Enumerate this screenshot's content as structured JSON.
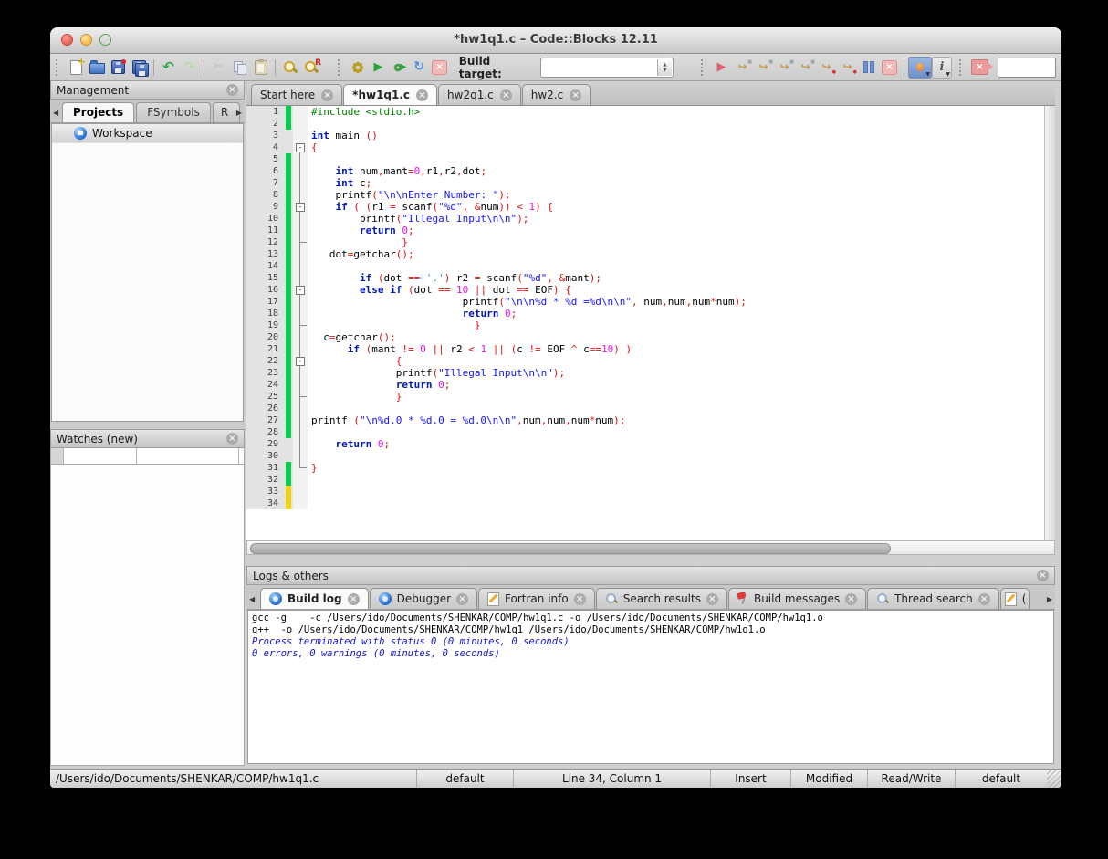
{
  "window": {
    "title": "*hw1q1.c – Code::Blocks 12.11"
  },
  "toolbar": {
    "build_target_label": "Build target:",
    "build_target_value": "",
    "search_value": ""
  },
  "icons": {
    "undo": "↶",
    "redo": "↷",
    "cut": "✂",
    "run": "▶",
    "rebuild": "↻",
    "debug_continue": "▶",
    "step": "↪",
    "close": "×",
    "fold_collapse": "-",
    "scroll_left": "◀",
    "scroll_right": "▶",
    "stepper_up": "▲",
    "stepper_down": "▼",
    "abort_x": "×",
    "info": "i",
    "shape_icons": "new-file:page-plus, open-file:folder, save:floppy, save-all:floppies, copy:pages, paste:clipboard, find:magnifier, replace:magnifier-R, build:gear, build-and-run:gear-play, pause:bars, debugging-windows:bug, incremental-search:pink-arrow-x, workspace:blue-sphere, build-log:blue-gear, fortran:pencil, search:magnifier, build-messages:red-flag"
  },
  "colors": {
    "change_bar_saved": "#00d24b",
    "change_bar_unsaved": "#f2d40e",
    "preprocessor": "#008000",
    "keyword": "#0018b4",
    "string": "#1414ff",
    "character": "#2e9bd6",
    "number": "#e813e8",
    "operator": "#e01010"
  },
  "sidebar": {
    "management": {
      "title": "Management",
      "tabs": [
        {
          "label": "Projects",
          "active": true,
          "partial": false
        },
        {
          "label": "FSymbols",
          "active": false,
          "partial": false
        },
        {
          "label": "R",
          "active": false,
          "partial": true
        }
      ],
      "workspace_label": "Workspace"
    },
    "watches": {
      "title": "Watches (new)"
    }
  },
  "editor": {
    "tabs": [
      {
        "label": "Start here",
        "active": false
      },
      {
        "label": "*hw1q1.c",
        "active": true
      },
      {
        "label": "hw2q1.c",
        "active": false
      },
      {
        "label": "hw2.c",
        "active": false
      }
    ],
    "lines": [
      {
        "n": 1,
        "bar": "g",
        "fold": "",
        "segs": [
          [
            "#include <stdio.h>",
            "pre"
          ]
        ]
      },
      {
        "n": 2,
        "bar": "g",
        "fold": "",
        "segs": []
      },
      {
        "n": 3,
        "bar": "",
        "fold": "",
        "segs": [
          [
            "int",
            "kw"
          ],
          [
            " main ",
            "pl"
          ],
          [
            "()",
            "op"
          ]
        ]
      },
      {
        "n": 4,
        "bar": "",
        "fold": "boxfirst",
        "segs": [
          [
            "{",
            "op"
          ]
        ]
      },
      {
        "n": 5,
        "bar": "g",
        "fold": "line",
        "segs": []
      },
      {
        "n": 6,
        "bar": "g",
        "fold": "line",
        "segs": [
          [
            "    ",
            "pl"
          ],
          [
            "int",
            "kw"
          ],
          [
            " num",
            "pl"
          ],
          [
            ",",
            "op"
          ],
          [
            "mant",
            "pl"
          ],
          [
            "=",
            "op"
          ],
          [
            "0",
            "num"
          ],
          [
            ",",
            "op"
          ],
          [
            "r1",
            "pl"
          ],
          [
            ",",
            "op"
          ],
          [
            "r2",
            "pl"
          ],
          [
            ",",
            "op"
          ],
          [
            "dot",
            "pl"
          ],
          [
            ";",
            "op"
          ]
        ]
      },
      {
        "n": 7,
        "bar": "g",
        "fold": "line",
        "segs": [
          [
            "    ",
            "pl"
          ],
          [
            "int",
            "kw"
          ],
          [
            " c",
            "pl"
          ],
          [
            ";",
            "op"
          ]
        ]
      },
      {
        "n": 8,
        "bar": "g",
        "fold": "line",
        "segs": [
          [
            "    printf",
            "pl"
          ],
          [
            "(",
            "op"
          ],
          [
            "\"\\n\\nEnter Number: \"",
            "str"
          ],
          [
            ");",
            "op"
          ]
        ]
      },
      {
        "n": 9,
        "bar": "g",
        "fold": "box",
        "segs": [
          [
            "    ",
            "pl"
          ],
          [
            "if",
            "kw"
          ],
          [
            " ",
            "pl"
          ],
          [
            "( (",
            "op"
          ],
          [
            "r1 ",
            "pl"
          ],
          [
            "=",
            "op"
          ],
          [
            " scanf",
            "pl"
          ],
          [
            "(",
            "op"
          ],
          [
            "\"%d\"",
            "str"
          ],
          [
            ",",
            "op"
          ],
          [
            " ",
            "pl"
          ],
          [
            "&",
            "op"
          ],
          [
            "num",
            "pl"
          ],
          [
            "))",
            "op"
          ],
          [
            " ",
            "pl"
          ],
          [
            "<",
            "op"
          ],
          [
            " ",
            "pl"
          ],
          [
            "1",
            "num"
          ],
          [
            ")",
            "op"
          ],
          [
            " ",
            "pl"
          ],
          [
            "{",
            "op"
          ]
        ]
      },
      {
        "n": 10,
        "bar": "g",
        "fold": "line",
        "segs": [
          [
            "        printf",
            "pl"
          ],
          [
            "(",
            "op"
          ],
          [
            "\"Illegal Input\\n\\n\"",
            "str"
          ],
          [
            ");",
            "op"
          ]
        ]
      },
      {
        "n": 11,
        "bar": "g",
        "fold": "line",
        "segs": [
          [
            "        ",
            "pl"
          ],
          [
            "return",
            "kw"
          ],
          [
            " ",
            "pl"
          ],
          [
            "0",
            "num"
          ],
          [
            ";",
            "op"
          ]
        ]
      },
      {
        "n": 12,
        "bar": "g",
        "fold": "tick",
        "segs": [
          [
            "               ",
            "pl"
          ],
          [
            "}",
            "op"
          ]
        ]
      },
      {
        "n": 13,
        "bar": "g",
        "fold": "line",
        "segs": [
          [
            "   dot",
            "pl"
          ],
          [
            "=",
            "op"
          ],
          [
            "getchar",
            "pl"
          ],
          [
            "();",
            "op"
          ]
        ]
      },
      {
        "n": 14,
        "bar": "g",
        "fold": "line",
        "segs": []
      },
      {
        "n": 15,
        "bar": "g",
        "fold": "line",
        "segs": [
          [
            "        ",
            "pl"
          ],
          [
            "if",
            "kw"
          ],
          [
            " ",
            "pl"
          ],
          [
            "(",
            "op"
          ],
          [
            "dot ",
            "pl"
          ],
          [
            "==",
            "op"
          ],
          [
            " ",
            "pl"
          ],
          [
            "'.'",
            "chr"
          ],
          [
            ")",
            "op"
          ],
          [
            " r2 ",
            "pl"
          ],
          [
            "=",
            "op"
          ],
          [
            " scanf",
            "pl"
          ],
          [
            "(",
            "op"
          ],
          [
            "\"%d\"",
            "str"
          ],
          [
            ",",
            "op"
          ],
          [
            " ",
            "pl"
          ],
          [
            "&",
            "op"
          ],
          [
            "mant",
            "pl"
          ],
          [
            ");",
            "op"
          ]
        ]
      },
      {
        "n": 16,
        "bar": "g",
        "fold": "box",
        "segs": [
          [
            "        ",
            "pl"
          ],
          [
            "else",
            "kw"
          ],
          [
            " ",
            "pl"
          ],
          [
            "if",
            "kw"
          ],
          [
            " ",
            "pl"
          ],
          [
            "(",
            "op"
          ],
          [
            "dot ",
            "pl"
          ],
          [
            "==",
            "op"
          ],
          [
            " ",
            "pl"
          ],
          [
            "10",
            "num"
          ],
          [
            " ",
            "pl"
          ],
          [
            "||",
            "op"
          ],
          [
            " dot ",
            "pl"
          ],
          [
            "==",
            "op"
          ],
          [
            " EOF",
            "pl"
          ],
          [
            ")",
            "op"
          ],
          [
            " ",
            "pl"
          ],
          [
            "{",
            "op"
          ]
        ]
      },
      {
        "n": 17,
        "bar": "g",
        "fold": "line",
        "segs": [
          [
            "                         printf",
            "pl"
          ],
          [
            "(",
            "op"
          ],
          [
            "\"\\n\\n%d * %d =%d\\n\\n\"",
            "str"
          ],
          [
            ",",
            "op"
          ],
          [
            " num",
            "pl"
          ],
          [
            ",",
            "op"
          ],
          [
            "num",
            "pl"
          ],
          [
            ",",
            "op"
          ],
          [
            "num",
            "pl"
          ],
          [
            "*",
            "op"
          ],
          [
            "num",
            "pl"
          ],
          [
            ");",
            "op"
          ]
        ]
      },
      {
        "n": 18,
        "bar": "g",
        "fold": "line",
        "segs": [
          [
            "                         ",
            "pl"
          ],
          [
            "return",
            "kw"
          ],
          [
            " ",
            "pl"
          ],
          [
            "0",
            "num"
          ],
          [
            ";",
            "op"
          ]
        ]
      },
      {
        "n": 19,
        "bar": "g",
        "fold": "tick",
        "segs": [
          [
            "                           ",
            "pl"
          ],
          [
            "}",
            "op"
          ]
        ]
      },
      {
        "n": 20,
        "bar": "g",
        "fold": "line",
        "segs": [
          [
            "  c",
            "pl"
          ],
          [
            "=",
            "op"
          ],
          [
            "getchar",
            "pl"
          ],
          [
            "();",
            "op"
          ]
        ]
      },
      {
        "n": 21,
        "bar": "g",
        "fold": "line",
        "segs": [
          [
            "      ",
            "pl"
          ],
          [
            "if",
            "kw"
          ],
          [
            " ",
            "pl"
          ],
          [
            "(",
            "op"
          ],
          [
            "mant ",
            "pl"
          ],
          [
            "!=",
            "op"
          ],
          [
            " ",
            "pl"
          ],
          [
            "0",
            "num"
          ],
          [
            " ",
            "pl"
          ],
          [
            "||",
            "op"
          ],
          [
            " r2 ",
            "pl"
          ],
          [
            "<",
            "op"
          ],
          [
            " ",
            "pl"
          ],
          [
            "1",
            "num"
          ],
          [
            " ",
            "pl"
          ],
          [
            "||",
            "op"
          ],
          [
            " ",
            "pl"
          ],
          [
            "(",
            "op"
          ],
          [
            "c ",
            "pl"
          ],
          [
            "!=",
            "op"
          ],
          [
            " EOF ",
            "pl"
          ],
          [
            "^",
            "op"
          ],
          [
            " c",
            "pl"
          ],
          [
            "==",
            "op"
          ],
          [
            "10",
            "num"
          ],
          [
            ")",
            "op"
          ],
          [
            " ",
            "pl"
          ],
          [
            ")",
            "op"
          ]
        ]
      },
      {
        "n": 22,
        "bar": "g",
        "fold": "box",
        "segs": [
          [
            "              ",
            "pl"
          ],
          [
            "{",
            "op"
          ]
        ]
      },
      {
        "n": 23,
        "bar": "g",
        "fold": "line",
        "segs": [
          [
            "              printf",
            "pl"
          ],
          [
            "(",
            "op"
          ],
          [
            "\"Illegal Input\\n\\n\"",
            "str"
          ],
          [
            ");",
            "op"
          ]
        ]
      },
      {
        "n": 24,
        "bar": "g",
        "fold": "line",
        "segs": [
          [
            "              ",
            "pl"
          ],
          [
            "return",
            "kw"
          ],
          [
            " ",
            "pl"
          ],
          [
            "0",
            "num"
          ],
          [
            ";",
            "op"
          ]
        ]
      },
      {
        "n": 25,
        "bar": "g",
        "fold": "tick",
        "segs": [
          [
            "              ",
            "pl"
          ],
          [
            "}",
            "op"
          ]
        ]
      },
      {
        "n": 26,
        "bar": "g",
        "fold": "line",
        "segs": []
      },
      {
        "n": 27,
        "bar": "g",
        "fold": "line",
        "segs": [
          [
            "printf ",
            "pl"
          ],
          [
            "(",
            "op"
          ],
          [
            "\"\\n%d.0 * %d.0 = %d.0\\n\\n\"",
            "str"
          ],
          [
            ",",
            "op"
          ],
          [
            "num",
            "pl"
          ],
          [
            ",",
            "op"
          ],
          [
            "num",
            "pl"
          ],
          [
            ",",
            "op"
          ],
          [
            "num",
            "pl"
          ],
          [
            "*",
            "op"
          ],
          [
            "num",
            "pl"
          ],
          [
            ");",
            "op"
          ]
        ]
      },
      {
        "n": 28,
        "bar": "g",
        "fold": "line",
        "segs": []
      },
      {
        "n": 29,
        "bar": "",
        "fold": "line",
        "segs": [
          [
            "    ",
            "pl"
          ],
          [
            "return",
            "kw"
          ],
          [
            " ",
            "pl"
          ],
          [
            "0",
            "num"
          ],
          [
            ";",
            "op"
          ]
        ]
      },
      {
        "n": 30,
        "bar": "",
        "fold": "line",
        "segs": []
      },
      {
        "n": 31,
        "bar": "g",
        "fold": "end",
        "segs": [
          [
            "}",
            "op"
          ]
        ]
      },
      {
        "n": 32,
        "bar": "g",
        "fold": "",
        "segs": []
      },
      {
        "n": 33,
        "bar": "y",
        "fold": "",
        "segs": []
      },
      {
        "n": 34,
        "bar": "y",
        "fold": "",
        "segs": []
      }
    ]
  },
  "logs": {
    "title": "Logs & others",
    "tabs": [
      {
        "label": "Build log",
        "icon": "gearblue",
        "active": true,
        "partial": false
      },
      {
        "label": "Debugger",
        "icon": "gearblue",
        "active": false,
        "partial": false
      },
      {
        "label": "Fortran info",
        "icon": "pencil",
        "active": false,
        "partial": false
      },
      {
        "label": "Search results",
        "icon": "magsm",
        "active": false,
        "partial": false
      },
      {
        "label": "Build messages",
        "icon": "flag",
        "active": false,
        "partial": false
      },
      {
        "label": "Thread search",
        "icon": "magsm",
        "active": false,
        "partial": false
      },
      {
        "label": "(",
        "icon": "pencil",
        "active": false,
        "partial": true
      }
    ],
    "lines": [
      {
        "text": "gcc -g    -c /Users/ido/Documents/SHENKAR/COMP/hw1q1.c -o /Users/ido/Documents/SHENKAR/COMP/hw1q1.o",
        "style": "plain"
      },
      {
        "text": "g++  -o /Users/ido/Documents/SHENKAR/COMP/hw1q1 /Users/ido/Documents/SHENKAR/COMP/hw1q1.o",
        "style": "plain"
      },
      {
        "text": "Process terminated with status 0 (0 minutes, 0 seconds)",
        "style": "info"
      },
      {
        "text": "0 errors, 0 warnings (0 minutes, 0 seconds)",
        "style": "info"
      }
    ]
  },
  "statusbar": {
    "fields": [
      "/Users/ido/Documents/SHENKAR/COMP/hw1q1.c",
      "default",
      "Line 34, Column 1",
      "Insert",
      "Modified",
      "Read/Write",
      "default"
    ]
  }
}
